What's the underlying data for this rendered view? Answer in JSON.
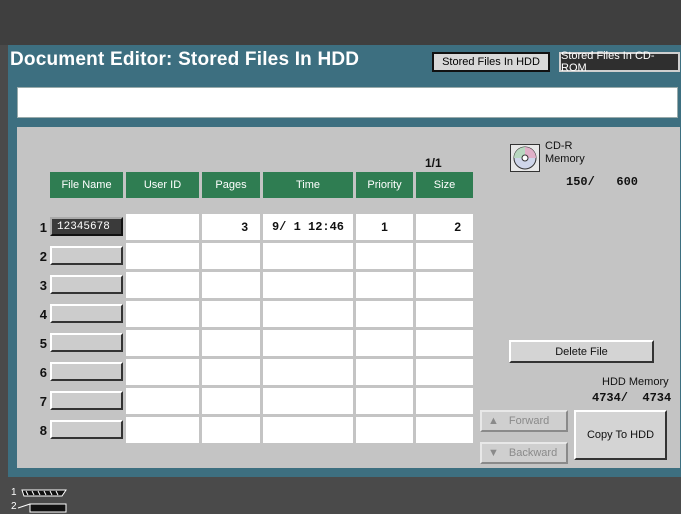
{
  "header": {
    "title": "Document Editor: Stored Files In HDD",
    "tab_hdd": "Stored Files In HDD",
    "tab_cdrom": "Stored Files In CD-ROM"
  },
  "message": "",
  "table": {
    "page_indicator": "1/1",
    "columns": [
      "File Name",
      "User ID",
      "Pages",
      "Time",
      "Priority",
      "Size"
    ],
    "rows": [
      {
        "num": "1",
        "file_name": "12345678",
        "user_id": "",
        "pages": "3",
        "time": "9/ 1 12:46",
        "priority": "1",
        "size": "2"
      },
      {
        "num": "2",
        "file_name": "",
        "user_id": "",
        "pages": "",
        "time": "",
        "priority": "",
        "size": ""
      },
      {
        "num": "3",
        "file_name": "",
        "user_id": "",
        "pages": "",
        "time": "",
        "priority": "",
        "size": ""
      },
      {
        "num": "4",
        "file_name": "",
        "user_id": "",
        "pages": "",
        "time": "",
        "priority": "",
        "size": ""
      },
      {
        "num": "5",
        "file_name": "",
        "user_id": "",
        "pages": "",
        "time": "",
        "priority": "",
        "size": ""
      },
      {
        "num": "6",
        "file_name": "",
        "user_id": "",
        "pages": "",
        "time": "",
        "priority": "",
        "size": ""
      },
      {
        "num": "7",
        "file_name": "",
        "user_id": "",
        "pages": "",
        "time": "",
        "priority": "",
        "size": ""
      },
      {
        "num": "8",
        "file_name": "",
        "user_id": "",
        "pages": "",
        "time": "",
        "priority": "",
        "size": ""
      }
    ]
  },
  "cdr": {
    "label1": "CD-R",
    "label2": "Memory",
    "value": "150/   600",
    "icon": "cd-icon"
  },
  "actions": {
    "delete_file": "Delete File",
    "forward": "Forward",
    "backward": "Backward",
    "copy_to_hdd": "Copy To HDD",
    "forward_icon": "▲",
    "backward_icon": "▼"
  },
  "hdd": {
    "label": "HDD Memory",
    "value": "4734/  4734"
  },
  "tray": {
    "label1": "1",
    "label2": "2",
    "icon": "paper-tray-icon"
  },
  "colors": {
    "frame": "#3d6f80",
    "header_green": "#2f7d52",
    "panel": "#c4c4c4"
  }
}
